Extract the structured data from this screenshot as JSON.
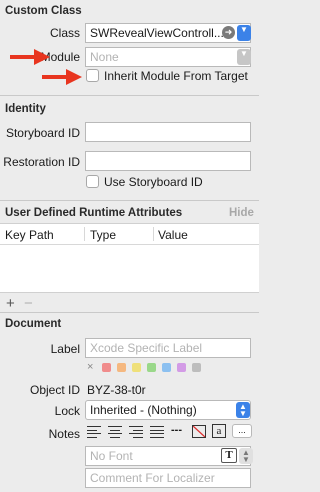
{
  "custom_class": {
    "title": "Custom Class",
    "class_label": "Class",
    "class_value": "SWRevealViewControll...",
    "module_label": "Module",
    "module_placeholder": "None",
    "inherit_label": "Inherit Module From Target"
  },
  "identity": {
    "title": "Identity",
    "storyboard_id_label": "Storyboard ID",
    "restoration_id_label": "Restoration ID",
    "use_storyboard_id_label": "Use Storyboard ID"
  },
  "runtime_attributes": {
    "title": "User Defined Runtime Attributes",
    "hide_label": "Hide",
    "columns": [
      "Key Path",
      "Type",
      "Value"
    ],
    "add_symbol": "+",
    "remove_symbol": "−"
  },
  "document": {
    "title": "Document",
    "label_label": "Label",
    "label_placeholder": "Xcode Specific Label",
    "swatch_x": "×",
    "swatch_colors": [
      "#f08c8c",
      "#f5b880",
      "#efe07a",
      "#9ad88a",
      "#8cc0f0",
      "#d39be6",
      "#bdbdbd"
    ],
    "object_id_label": "Object ID",
    "object_id_value": "BYZ-38-t0r",
    "lock_label": "Lock",
    "lock_value": "Inherited - (Nothing)",
    "notes_label": "Notes",
    "font_placeholder": "No Font",
    "comment_placeholder": "Comment For Localizer",
    "dashes": "---",
    "more": "..."
  },
  "accent_color": "#3b82e8",
  "arrow_color": "#e8351f"
}
